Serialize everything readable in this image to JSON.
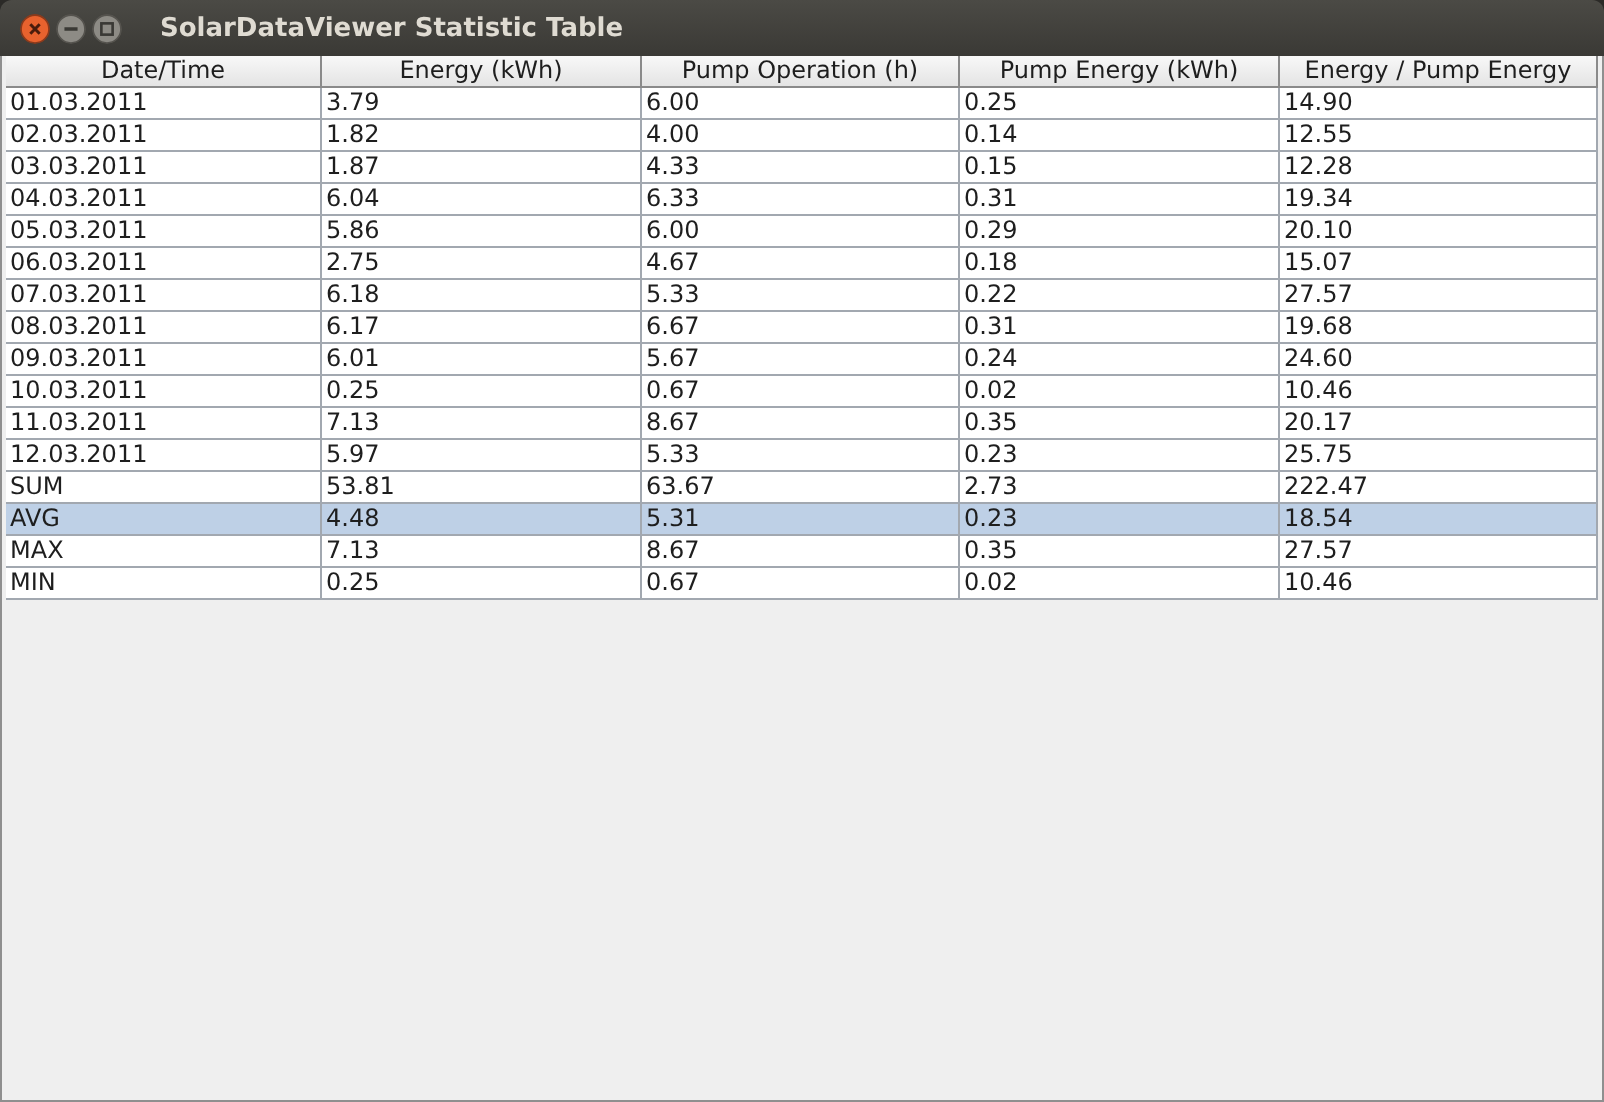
{
  "window": {
    "title": "SolarDataViewer Statistic Table"
  },
  "table": {
    "columns": [
      "Date/Time",
      "Energy (kWh)",
      "Pump Operation (h)",
      "Pump Energy (kWh)",
      "Energy / Pump Energy"
    ],
    "rows": [
      {
        "cells": [
          "01.03.2011",
          "3.79",
          "6.00",
          "0.25",
          "14.90"
        ],
        "selected": false
      },
      {
        "cells": [
          "02.03.2011",
          "1.82",
          "4.00",
          "0.14",
          "12.55"
        ],
        "selected": false
      },
      {
        "cells": [
          "03.03.2011",
          "1.87",
          "4.33",
          "0.15",
          "12.28"
        ],
        "selected": false
      },
      {
        "cells": [
          "04.03.2011",
          "6.04",
          "6.33",
          "0.31",
          "19.34"
        ],
        "selected": false
      },
      {
        "cells": [
          "05.03.2011",
          "5.86",
          "6.00",
          "0.29",
          "20.10"
        ],
        "selected": false
      },
      {
        "cells": [
          "06.03.2011",
          "2.75",
          "4.67",
          "0.18",
          "15.07"
        ],
        "selected": false
      },
      {
        "cells": [
          "07.03.2011",
          "6.18",
          "5.33",
          "0.22",
          "27.57"
        ],
        "selected": false
      },
      {
        "cells": [
          "08.03.2011",
          "6.17",
          "6.67",
          "0.31",
          "19.68"
        ],
        "selected": false
      },
      {
        "cells": [
          "09.03.2011",
          "6.01",
          "5.67",
          "0.24",
          "24.60"
        ],
        "selected": false
      },
      {
        "cells": [
          "10.03.2011",
          "0.25",
          "0.67",
          "0.02",
          "10.46"
        ],
        "selected": false
      },
      {
        "cells": [
          "11.03.2011",
          "7.13",
          "8.67",
          "0.35",
          "20.17"
        ],
        "selected": false
      },
      {
        "cells": [
          "12.03.2011",
          "5.97",
          "5.33",
          "0.23",
          "25.75"
        ],
        "selected": false
      },
      {
        "cells": [
          "SUM",
          "53.81",
          "63.67",
          "2.73",
          "222.47"
        ],
        "selected": false
      },
      {
        "cells": [
          "AVG",
          "4.48",
          "5.31",
          "0.23",
          "18.54"
        ],
        "selected": true
      },
      {
        "cells": [
          "MAX",
          "7.13",
          "8.67",
          "0.35",
          "27.57"
        ],
        "selected": false
      },
      {
        "cells": [
          "MIN",
          "0.25",
          "0.67",
          "0.02",
          "10.46"
        ],
        "selected": false
      }
    ]
  }
}
